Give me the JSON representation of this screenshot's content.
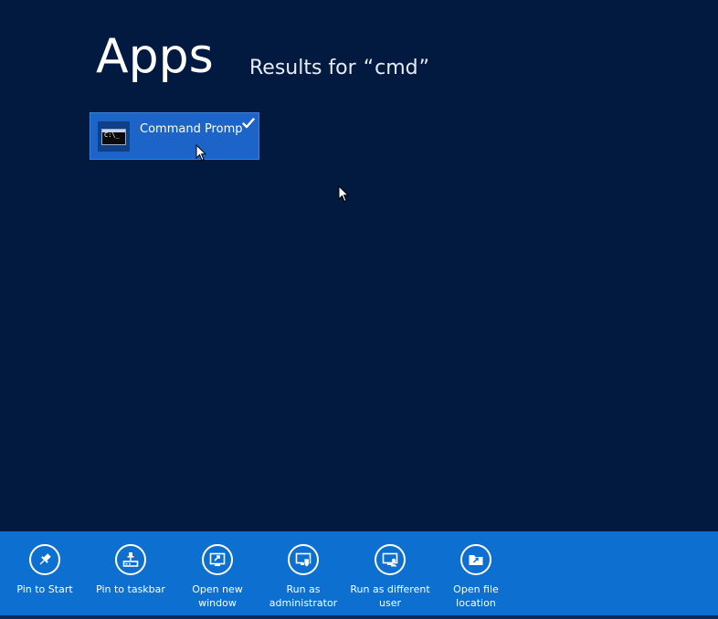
{
  "header": {
    "title": "Apps",
    "results_prefix": "Results for",
    "query_open": "“",
    "query": "cmd",
    "query_close": "”"
  },
  "results": [
    {
      "label": "Command Prompt",
      "icon_text": "C:\\_",
      "selected": true,
      "icon": "command-prompt-icon"
    }
  ],
  "app_bar": {
    "commands": [
      {
        "label": "Pin to Start",
        "icon": "pin-icon"
      },
      {
        "label": "Pin to taskbar",
        "icon": "pin-taskbar-icon"
      },
      {
        "label": "Open new\nwindow",
        "icon": "new-window-icon"
      },
      {
        "label": "Run as\nadministrator",
        "icon": "shield-admin-icon"
      },
      {
        "label": "Run as different\nuser",
        "icon": "different-user-icon"
      },
      {
        "label": "Open file\nlocation",
        "icon": "folder-location-icon"
      }
    ]
  },
  "colors": {
    "background": "#021a40",
    "tile": "#1c64c8",
    "app_bar": "#0d6fcf"
  }
}
